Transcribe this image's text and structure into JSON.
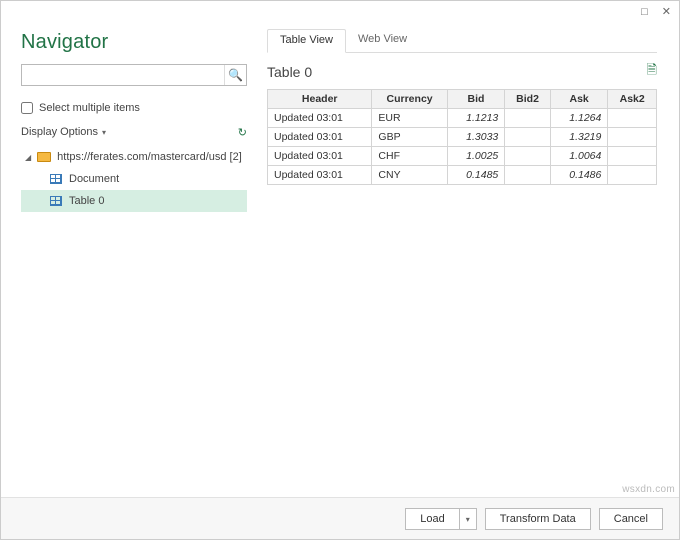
{
  "window": {
    "title": "Navigator"
  },
  "search": {
    "value": "",
    "placeholder": ""
  },
  "checkbox": {
    "select_multiple": "Select multiple items"
  },
  "display_options": {
    "label": "Display Options"
  },
  "tree": {
    "root_label": "https://ferates.com/mastercard/usd [2]",
    "items": [
      {
        "label": "Document"
      },
      {
        "label": "Table 0",
        "selected": true
      }
    ]
  },
  "tabs": {
    "table_view": "Table View",
    "web_view": "Web View"
  },
  "preview": {
    "title": "Table 0",
    "columns": [
      "Header",
      "Currency",
      "Bid",
      "Bid2",
      "Ask",
      "Ask2"
    ],
    "rows": [
      {
        "header": "Updated 03:01",
        "currency": "EUR",
        "bid": "1.1213",
        "bid2": "",
        "ask": "1.1264",
        "ask2": ""
      },
      {
        "header": "Updated 03:01",
        "currency": "GBP",
        "bid": "1.3033",
        "bid2": "",
        "ask": "1.3219",
        "ask2": ""
      },
      {
        "header": "Updated 03:01",
        "currency": "CHF",
        "bid": "1.0025",
        "bid2": "",
        "ask": "1.0064",
        "ask2": ""
      },
      {
        "header": "Updated 03:01",
        "currency": "CNY",
        "bid": "0.1485",
        "bid2": "",
        "ask": "0.1486",
        "ask2": ""
      }
    ]
  },
  "buttons": {
    "load": "Load",
    "transform": "Transform Data",
    "cancel": "Cancel"
  },
  "watermark": "wsxdn.com"
}
